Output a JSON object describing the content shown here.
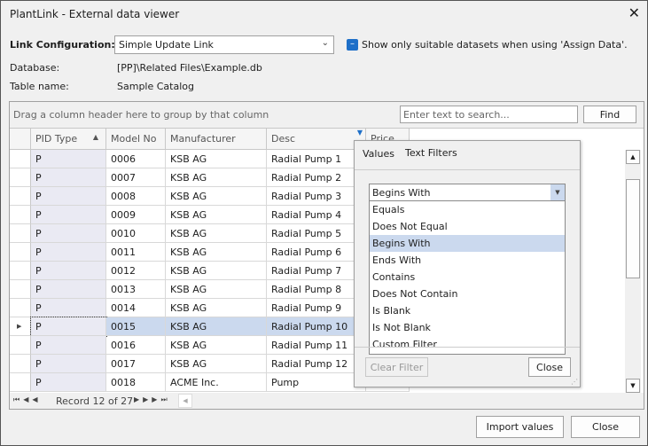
{
  "window": {
    "title": "PlantLink - External data viewer",
    "close_icon": "close-icon"
  },
  "config": {
    "link_label": "Link Configuration:",
    "link_value": "Simple Update Link",
    "checkbox_label": "Show only suitable datasets when using 'Assign Data'.",
    "checkbox_checked": true,
    "database_label": "Database:",
    "database_value": "[PP]\\Related Files\\Example.db",
    "table_label": "Table name:",
    "table_value": "Sample Catalog"
  },
  "grid": {
    "group_hint": "Drag a column header here to group by that column",
    "search_placeholder": "Enter text to search...",
    "find_label": "Find",
    "columns": [
      "PID Type",
      "Model No",
      "Manufacturer",
      "Desc",
      "Price"
    ],
    "rows": [
      [
        "P",
        "0006",
        "KSB AG",
        "Radial Pump 1"
      ],
      [
        "P",
        "0007",
        "KSB AG",
        "Radial Pump 2"
      ],
      [
        "P",
        "0008",
        "KSB AG",
        "Radial Pump 3"
      ],
      [
        "P",
        "0009",
        "KSB AG",
        "Radial Pump 4"
      ],
      [
        "P",
        "0010",
        "KSB AG",
        "Radial Pump 5"
      ],
      [
        "P",
        "0011",
        "KSB AG",
        "Radial Pump 6"
      ],
      [
        "P",
        "0012",
        "KSB AG",
        "Radial Pump 7"
      ],
      [
        "P",
        "0013",
        "KSB AG",
        "Radial Pump 8"
      ],
      [
        "P",
        "0014",
        "KSB AG",
        "Radial Pump 9"
      ],
      [
        "P",
        "0015",
        "KSB AG",
        "Radial Pump 10"
      ],
      [
        "P",
        "0016",
        "KSB AG",
        "Radial Pump 11"
      ],
      [
        "P",
        "0017",
        "KSB AG",
        "Radial Pump 12"
      ],
      [
        "P",
        "0018",
        "ACME Inc.",
        "Pump"
      ]
    ],
    "selected_row": 9,
    "navigator": "Record 12 of 27"
  },
  "filter_popup": {
    "tabs": [
      "Values",
      "Text Filters"
    ],
    "active_tab": 1,
    "selected": "Begins With",
    "options": [
      "Equals",
      "Does Not Equal",
      "Begins With",
      "Ends With",
      "Contains",
      "Does Not Contain",
      "Is Blank",
      "Is Not Blank",
      "Custom Filter"
    ],
    "clear_label": "Clear Filter",
    "close_label": "Close"
  },
  "footer": {
    "import_label": "Import values",
    "close_label": "Close"
  },
  "colors": {
    "accent": "#1e6fc8",
    "selection": "#cbd9ee"
  }
}
